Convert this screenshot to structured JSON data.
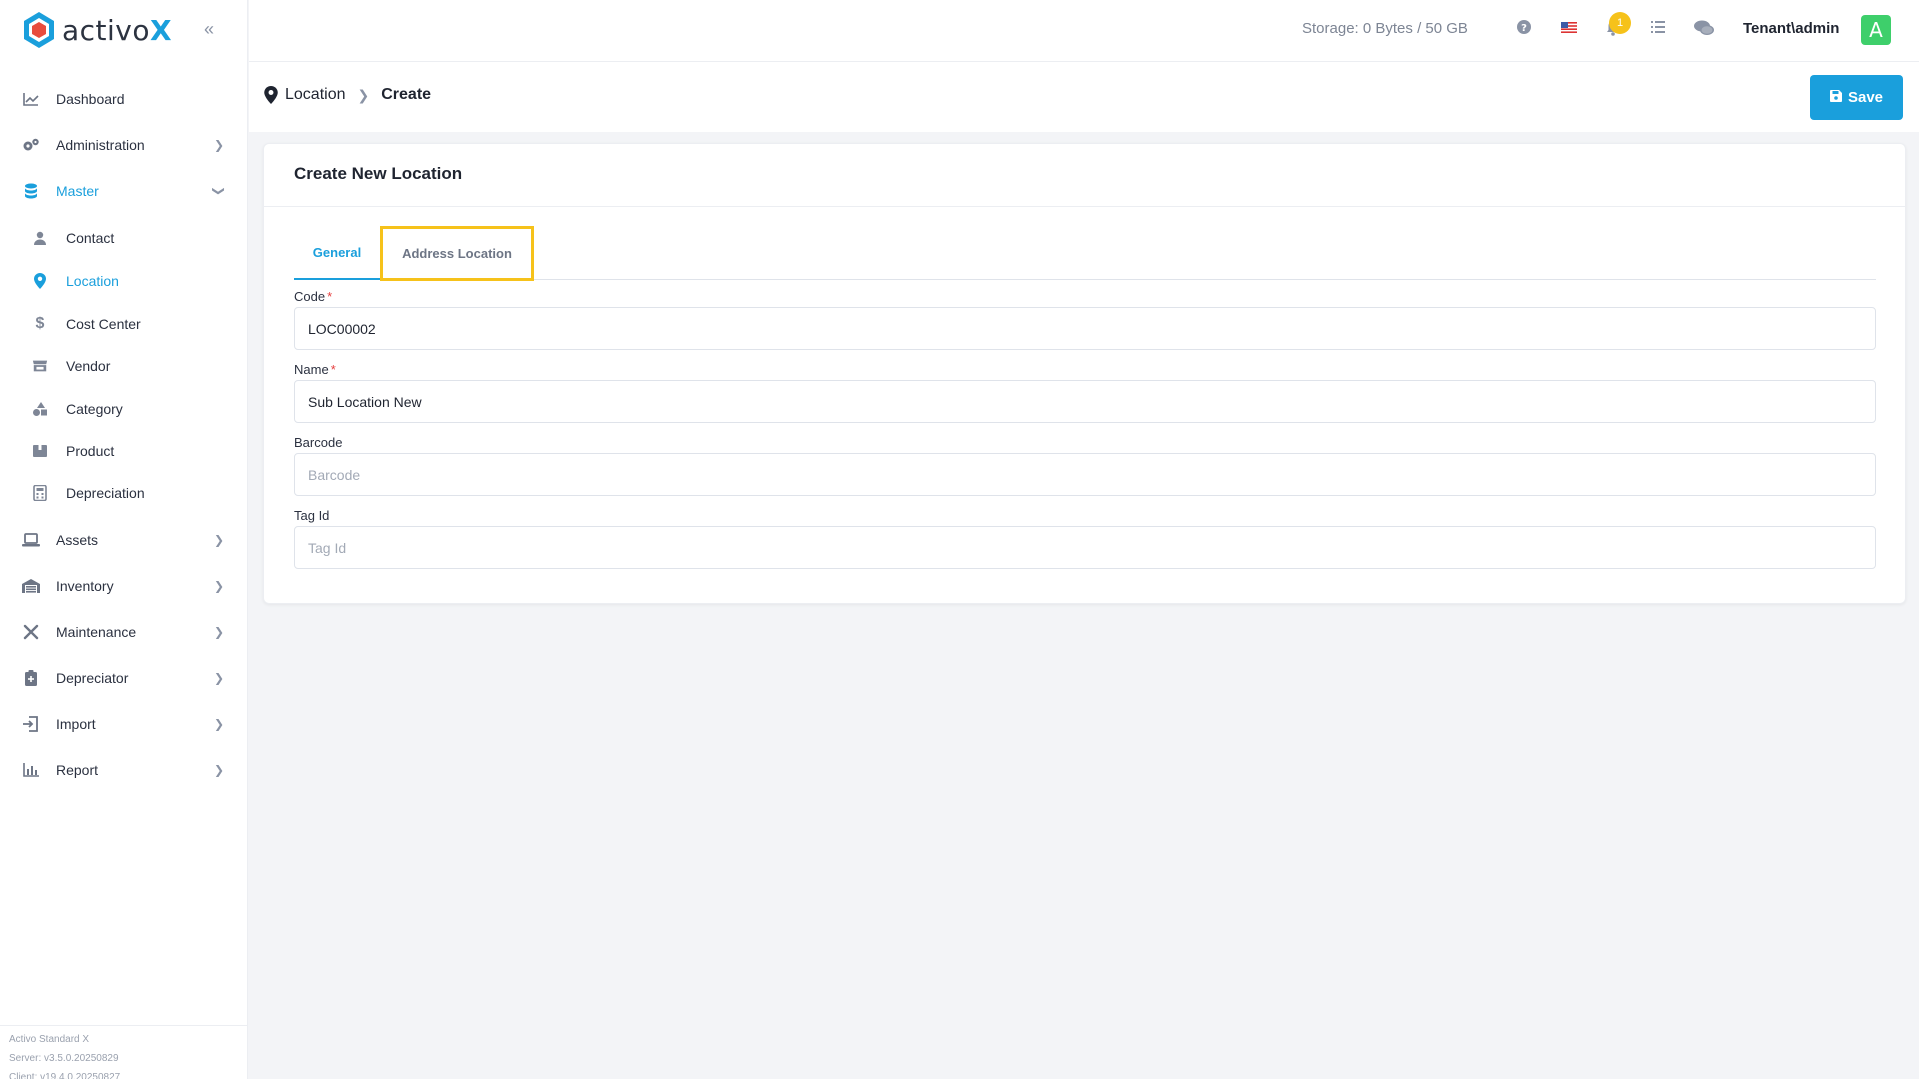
{
  "brand": {
    "name": "activo",
    "suffix": "X"
  },
  "sidebar": {
    "items": [
      {
        "label": "Dashboard",
        "icon": "chart-icon"
      },
      {
        "label": "Administration",
        "icon": "gears-icon",
        "chevron": "right"
      },
      {
        "label": "Master",
        "icon": "database-icon",
        "chevron": "down",
        "active": true
      },
      {
        "label": "Assets",
        "icon": "laptop-icon",
        "chevron": "right"
      },
      {
        "label": "Inventory",
        "icon": "warehouse-icon",
        "chevron": "right"
      },
      {
        "label": "Maintenance",
        "icon": "tools-icon",
        "chevron": "right"
      },
      {
        "label": "Depreciator",
        "icon": "clipboard-icon",
        "chevron": "right"
      },
      {
        "label": "Import",
        "icon": "import-icon",
        "chevron": "right"
      },
      {
        "label": "Report",
        "icon": "report-icon",
        "chevron": "right"
      }
    ],
    "sub_items": [
      {
        "label": "Contact",
        "icon": "user-icon"
      },
      {
        "label": "Location",
        "icon": "map-pin-icon",
        "active": true
      },
      {
        "label": "Cost Center",
        "icon": "dollar-icon"
      },
      {
        "label": "Vendor",
        "icon": "store-icon"
      },
      {
        "label": "Category",
        "icon": "shapes-icon"
      },
      {
        "label": "Product",
        "icon": "box-icon"
      },
      {
        "label": "Depreciation",
        "icon": "calculator-icon"
      }
    ],
    "footer": {
      "product": "Activo Standard X",
      "server": "Server: v3.5.0.20250829",
      "client": "Client: v19.4.0.20250827"
    }
  },
  "topbar": {
    "storage": "Storage: 0 Bytes / 50 GB",
    "notification_count": "1",
    "user": "Tenant\\admin",
    "avatar_letter": "A"
  },
  "breadcrumb": {
    "parent": "Location",
    "current": "Create"
  },
  "actions": {
    "save_label": "Save"
  },
  "form": {
    "title": "Create New Location",
    "tabs": [
      {
        "label": "General",
        "active": true
      },
      {
        "label": "Address Location",
        "highlighted": true
      }
    ],
    "fields": {
      "code": {
        "label": "Code",
        "value": "LOC00002",
        "placeholder": "Code",
        "required": true
      },
      "name": {
        "label": "Name",
        "value": "Sub Location New",
        "placeholder": "Name",
        "required": true
      },
      "barcode": {
        "label": "Barcode",
        "value": "",
        "placeholder": "Barcode"
      },
      "tag_id": {
        "label": "Tag Id",
        "value": "",
        "placeholder": "Tag Id"
      }
    }
  },
  "colors": {
    "accent": "#1a9fdc",
    "highlight": "#f6c21a",
    "avatar": "#3ecf6b",
    "required": "#e53e3e"
  }
}
